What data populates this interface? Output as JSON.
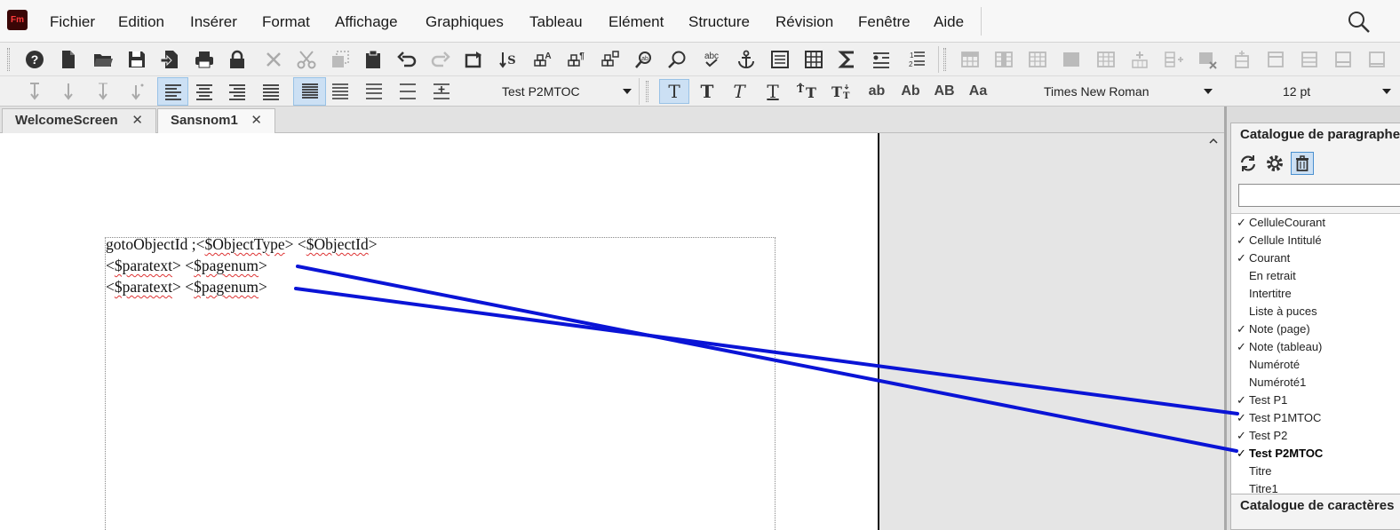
{
  "app": {
    "logo_text": "Fm"
  },
  "menu": [
    "Fichier",
    "Edition",
    "Insérer",
    "Format",
    "Affichage",
    "Graphiques",
    "Tableau",
    "Elément",
    "Structure",
    "Révision",
    "Fenêtre",
    "Aide"
  ],
  "toolbar": {
    "paragraph_format": "Test P2MTOC",
    "font_family": "Times New Roman",
    "font_size": "12 pt",
    "spell_check_label": "abc",
    "case_buttons": [
      "ab",
      "Ab",
      "AB",
      "Aa"
    ]
  },
  "tabs": [
    {
      "label": "WelcomeScreen",
      "close": "✕"
    },
    {
      "label": "Sansnom1",
      "close": "✕"
    }
  ],
  "document": {
    "lines": [
      [
        "gotoObjectId ;<",
        "$ObjectType",
        "> <",
        "$ObjectId",
        ">"
      ],
      [
        "<",
        "$paratext",
        "> <",
        "$pagenum",
        ">"
      ],
      [
        "<",
        "$paratext",
        "> <",
        "$pagenum",
        ">"
      ]
    ]
  },
  "paragraph_catalog": {
    "title": "Catalogue de paragraphes",
    "items": [
      {
        "check": "✓",
        "label": "CelluleCourant",
        "bold": false
      },
      {
        "check": "✓",
        "label": "Cellule Intitulé",
        "bold": false
      },
      {
        "check": "✓",
        "label": "Courant",
        "bold": false
      },
      {
        "check": "",
        "label": "En retrait",
        "bold": false
      },
      {
        "check": "",
        "label": "Intertitre",
        "bold": false
      },
      {
        "check": "",
        "label": "Liste à puces",
        "bold": false
      },
      {
        "check": "✓",
        "label": "Note (page)",
        "bold": false
      },
      {
        "check": "✓",
        "label": "Note (tableau)",
        "bold": false
      },
      {
        "check": "",
        "label": "Numéroté",
        "bold": false
      },
      {
        "check": "",
        "label": "Numéroté1",
        "bold": false
      },
      {
        "check": "✓",
        "label": "Test P1",
        "bold": false
      },
      {
        "check": "✓",
        "label": "Test P1MTOC",
        "bold": false
      },
      {
        "check": "✓",
        "label": "Test P2",
        "bold": false
      },
      {
        "check": "✓",
        "label": "Test P2MTOC",
        "bold": true
      },
      {
        "check": "",
        "label": "Titre",
        "bold": false
      },
      {
        "check": "",
        "label": "Titre1",
        "bold": false
      }
    ]
  },
  "character_catalog": {
    "title": "Catalogue de caractères"
  },
  "colors": {
    "annotation_line": "#0a14d6",
    "selection": "#cce0f4",
    "squiggle": "#dd3333"
  }
}
